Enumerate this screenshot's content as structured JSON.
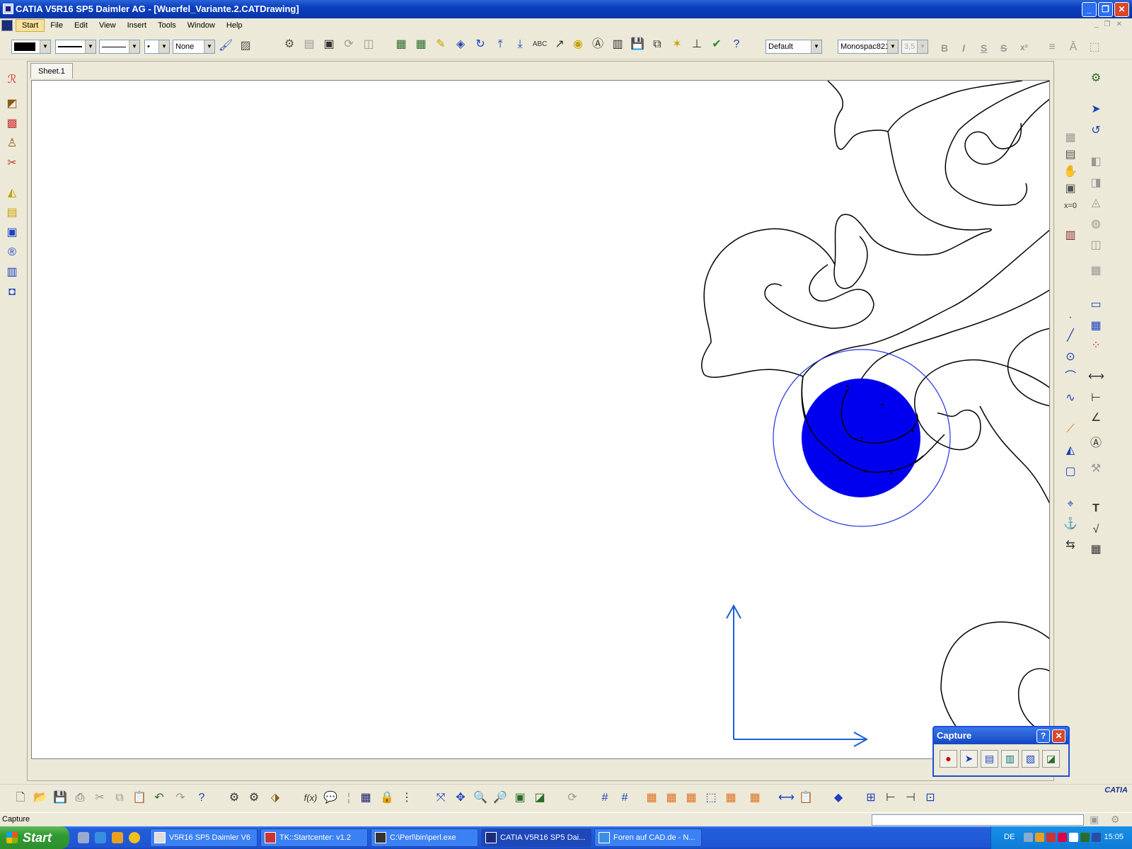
{
  "window": {
    "title": "CATIA V5R16 SP5 Daimler AG - [Wuerfel_Variante.2.CATDrawing]",
    "minimize_icon": "minimize-icon",
    "restore_icon": "restore-icon",
    "close_icon": "close-icon"
  },
  "menu": {
    "items": [
      "Start",
      "File",
      "Edit",
      "View",
      "Insert",
      "Tools",
      "Window",
      "Help"
    ]
  },
  "toolbar_top": {
    "line_style_none": "None",
    "view_style": "Default",
    "font_name": "Monospac821",
    "font_size": "3,5",
    "bold": "B",
    "italic": "I",
    "underline": "S",
    "strike": "S",
    "superscript": "x²"
  },
  "sheet": {
    "tab_label": "Sheet.1"
  },
  "capture_panel": {
    "title": "Capture",
    "help_label": "?",
    "close_label": "✕"
  },
  "status": {
    "text": "Capture"
  },
  "bottom_toolbar": {
    "logo_text": "CATIA"
  },
  "taskbar": {
    "start_label": "Start",
    "tasks": [
      {
        "label": "V5R16 SP5 Daimler V6"
      },
      {
        "label": "TK::Startcenter:  v1.2"
      },
      {
        "label": "C:\\Perl\\bin\\perl.exe"
      },
      {
        "label": "CATIA V5R16 SP5 Dai..."
      },
      {
        "label": "Foren auf CAD.de - N..."
      }
    ],
    "language": "DE",
    "clock": "15:05"
  },
  "colors": {
    "selection_fill": "#0000ee",
    "selection_circle": "#2233dd",
    "axis_color": "#1a5fd8",
    "titlebar": "#0a3fbf"
  }
}
